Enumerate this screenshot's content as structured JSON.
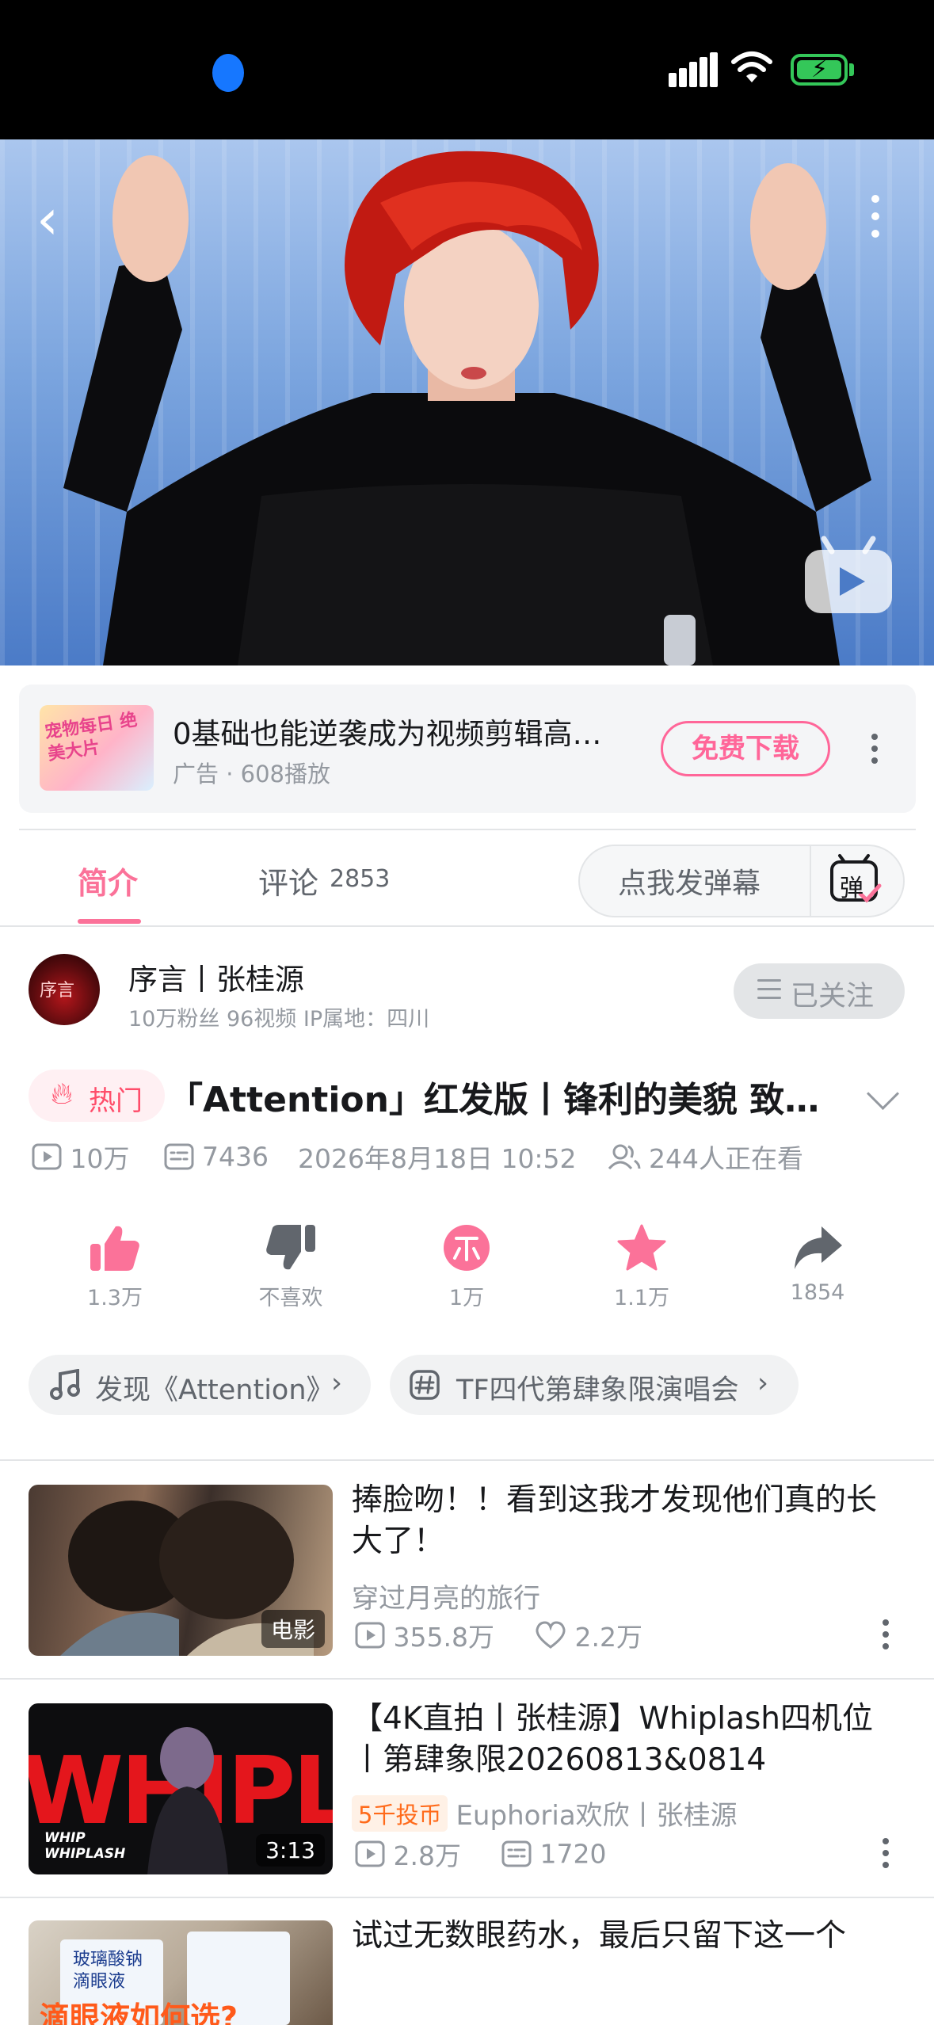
{
  "ad": {
    "thumb_text": "宠物每日 绝美大片",
    "title": "0基础也能逆袭成为视频剪辑高…",
    "subtitle": "广告 · 608播放",
    "button": "免费下载"
  },
  "tabs": {
    "intro": "简介",
    "comments": "评论",
    "comments_count": "2853",
    "danmaku_placeholder": "点我发弹幕",
    "danmaku_icon_char": "弹"
  },
  "uploader": {
    "name": "序言丨张桂源",
    "avatar_text": "序言",
    "stats": "10万粉丝   96视频   IP属地：四川",
    "follow_label": "已关注"
  },
  "video": {
    "hot_label": "热门",
    "title": "「Attention」红发版丨锋利的美貌 致…",
    "views": "10万",
    "danmaku": "7436",
    "date": "2026年8月18日 10:52",
    "watching": "244人正在看"
  },
  "actions": {
    "like": "1.3万",
    "dislike": "不喜欢",
    "coin": "1万",
    "favorite": "1.1万",
    "share": "1854"
  },
  "tags": {
    "music": "发现《Attention》",
    "topic": "TF四代第肆象限演唱会"
  },
  "feed": [
    {
      "title": "捧脸吻！！看到这我才发现他们真的长大了！",
      "badge": "电影",
      "author": "穿过月亮的旅行",
      "views": "355.8万",
      "likes": "2.2万"
    },
    {
      "title": "【4K直拍丨张桂源】Whiplash四机位丨第肆象限20260813&0814",
      "badge": "3:13",
      "thumb_big_text": "WHIPLASH",
      "thumb_small_text": "WHIP WHIPLASH",
      "coin_badge": "5千投币",
      "author": "Euphoria欢欣丨张桂源",
      "views": "2.8万",
      "danmaku": "1720"
    },
    {
      "title": "试过无数眼药水，最后只留下这一个",
      "thumb_text_1": "玻璃酸钠 滴眼液",
      "thumb_text_2": "滴眼液如何选?"
    }
  ],
  "colors": {
    "brand_pink": "#fb7299",
    "text_primary": "#18191c",
    "text_secondary": "#9499a0",
    "battery_green": "#34c759"
  }
}
